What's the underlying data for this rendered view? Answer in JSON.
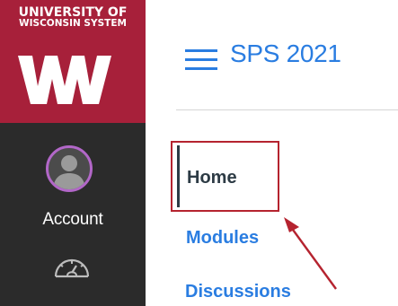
{
  "logo": {
    "line1": "UNIVERSITY OF",
    "line2": "WISCONSIN SYSTEM",
    "mark_icon": "uw-logo-mark",
    "background_color": "#a7203a"
  },
  "global_nav": {
    "background_color": "#2b2b2b",
    "account": {
      "label": "Account",
      "icon": "avatar-icon"
    },
    "dashboard": {
      "icon": "dashboard-gauge-icon"
    }
  },
  "header": {
    "menu_icon": "hamburger-menu-icon",
    "course_title": "SPS 2021"
  },
  "course_nav": {
    "items": [
      {
        "label": "Home",
        "active": true
      },
      {
        "label": "Modules",
        "active": false
      },
      {
        "label": "Discussions",
        "active": false
      }
    ]
  },
  "annotation": {
    "highlight_color": "#b5232f",
    "arrow_color": "#b5232f"
  },
  "colors": {
    "link": "#2a7de1",
    "active_text": "#2d3b45"
  }
}
